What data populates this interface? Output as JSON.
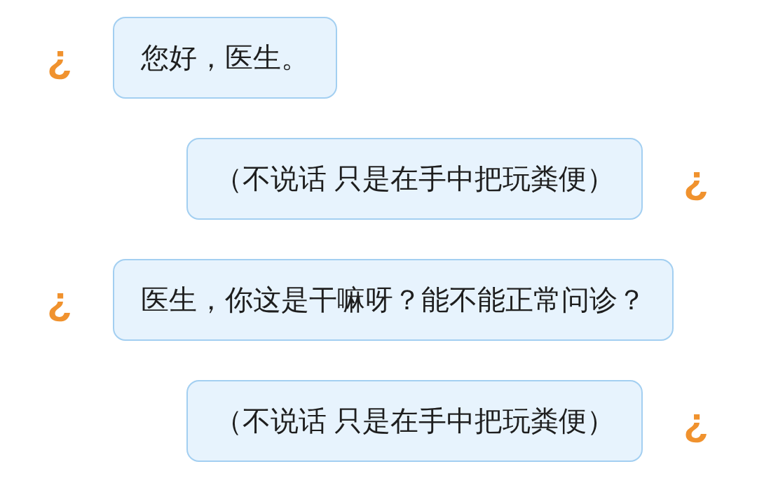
{
  "messages": [
    {
      "kind": "incoming",
      "avatar": "¿",
      "text": "您好，医生。"
    },
    {
      "kind": "outgoing",
      "avatar": "¿",
      "text": "（不说话 只是在手中把玩粪便）"
    },
    {
      "kind": "incoming",
      "avatar": "¿",
      "text": "医生，你这是干嘛呀？能不能正常问诊？"
    },
    {
      "kind": "outgoing",
      "avatar": "¿",
      "text": "（不说话 只是在手中把玩粪便）"
    }
  ]
}
